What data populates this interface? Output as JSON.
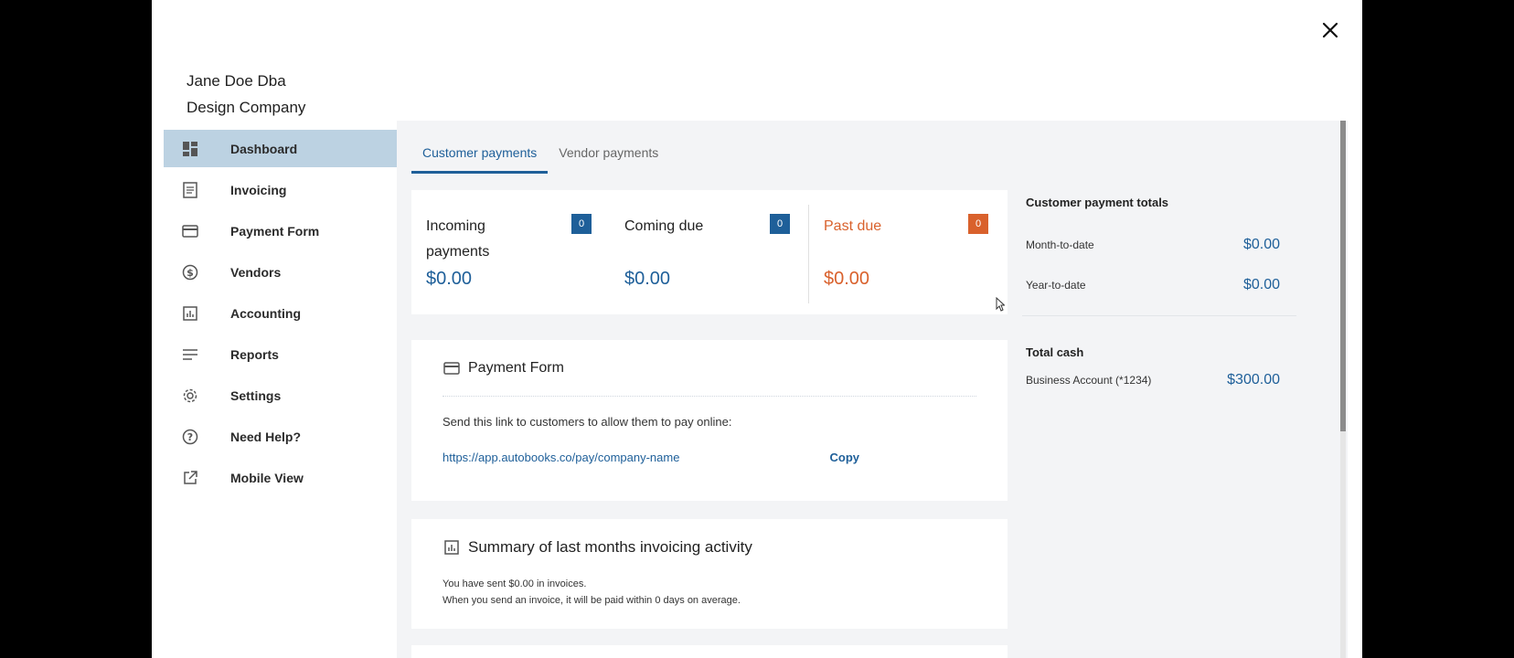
{
  "company": {
    "line1": "Jane Doe Dba",
    "line2": "Design Company"
  },
  "sidebar": {
    "items": [
      {
        "label": "Dashboard",
        "icon": "dashboard-icon",
        "active": true
      },
      {
        "label": "Invoicing",
        "icon": "invoice-icon"
      },
      {
        "label": "Payment Form",
        "icon": "credit-card-icon"
      },
      {
        "label": "Vendors",
        "icon": "dollar-circle-icon"
      },
      {
        "label": "Accounting",
        "icon": "bar-chart-icon"
      },
      {
        "label": "Reports",
        "icon": "lines-icon"
      },
      {
        "label": "Settings",
        "icon": "gear-icon"
      },
      {
        "label": "Need Help?",
        "icon": "help-circle-icon"
      },
      {
        "label": "Mobile View",
        "icon": "external-link-icon"
      }
    ]
  },
  "tabs": [
    {
      "label": "Customer payments",
      "active": true
    },
    {
      "label": "Vendor payments",
      "active": false
    }
  ],
  "stats": {
    "incoming": {
      "label": "Incoming payments",
      "count": "0",
      "amount": "$0.00"
    },
    "coming_due": {
      "label": "Coming due",
      "count": "0",
      "amount": "$0.00"
    },
    "past_due": {
      "label": "Past due",
      "count": "0",
      "amount": "$0.00"
    }
  },
  "payment_form": {
    "title": "Payment Form",
    "description": "Send this link to customers to allow them to pay online:",
    "link": "https://app.autobooks.co/pay/company-name",
    "copy_label": "Copy"
  },
  "summary": {
    "title": "Summary of last months invoicing activity",
    "line1": "You have sent $0.00 in invoices.",
    "line2": "When you send an invoice, it will be paid within 0 days on average."
  },
  "totals": {
    "heading": "Customer payment totals",
    "month_label": "Month-to-date",
    "month_value": "$0.00",
    "year_label": "Year-to-date",
    "year_value": "$0.00"
  },
  "cash": {
    "heading": "Total cash",
    "account_label": "Business Account (*1234)",
    "account_value": "$300.00"
  },
  "colors": {
    "accent": "#1e5f99",
    "past_due": "#d9612c",
    "active_nav": "#bcd2e2"
  }
}
